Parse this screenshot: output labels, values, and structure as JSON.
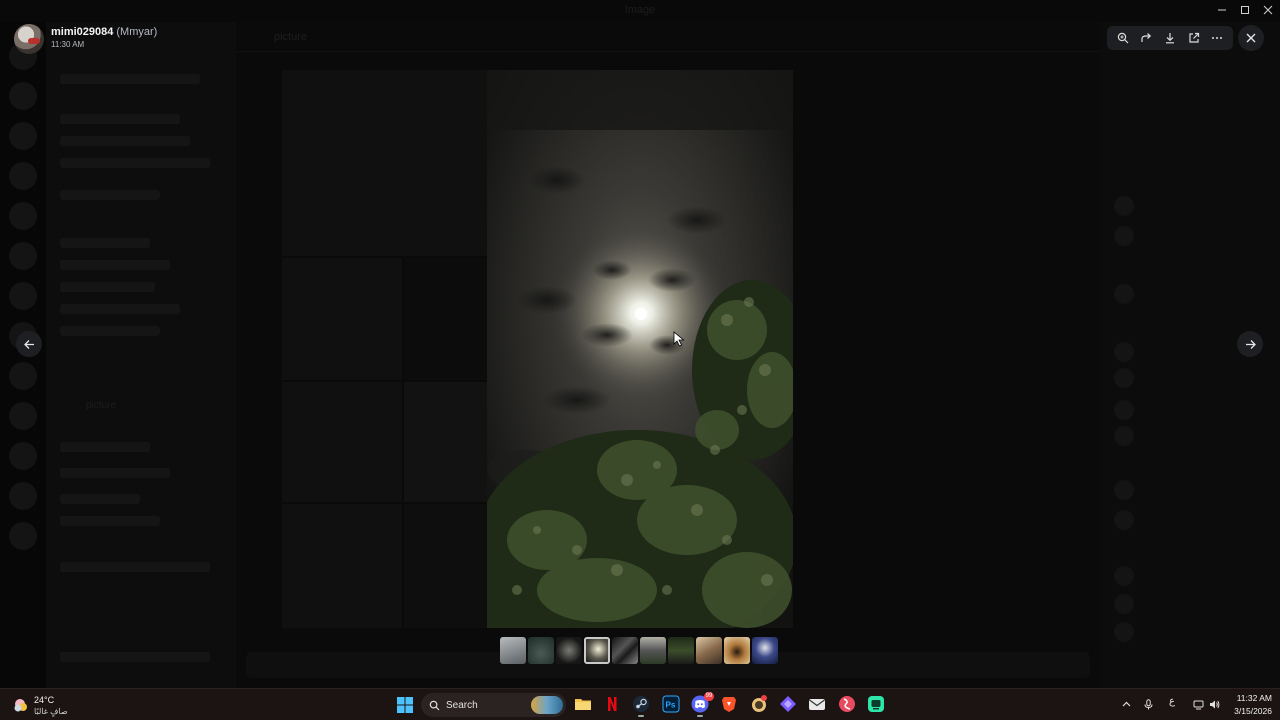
{
  "window": {
    "title": "Image"
  },
  "uploader": {
    "name": "mimi029084",
    "nickname": "(Mmyar)",
    "time": "11:30 AM"
  },
  "toolbar": {
    "icons": [
      "zoom-in-icon",
      "forward-icon",
      "download-icon",
      "open-external-icon",
      "more-icon"
    ]
  },
  "background": {
    "channel_name": "picture"
  },
  "viewer": {
    "image_description": "Night sky with moon behind clouds, tree branches in foreground",
    "thumbnail_count": 10,
    "active_thumbnail_index": 3
  },
  "taskbar": {
    "weather_temp": "24°C",
    "weather_desc": "صافٍ غالبًا",
    "search_label": "Search",
    "apps": [
      "file-explorer-icon",
      "netflix-icon",
      "steam-icon",
      "photoshop-icon",
      "discord-icon",
      "brave-icon",
      "app-icon",
      "app-icon",
      "mail-icon",
      "app-icon",
      "app-icon"
    ],
    "discord_badge": "99",
    "ime_indicator": "ع",
    "time": "11:32 AM",
    "date": "3/15/2026"
  },
  "colors": {
    "accent": "#1e1f22",
    "taskbar": "#1c1413",
    "badge": "#f23f43"
  }
}
